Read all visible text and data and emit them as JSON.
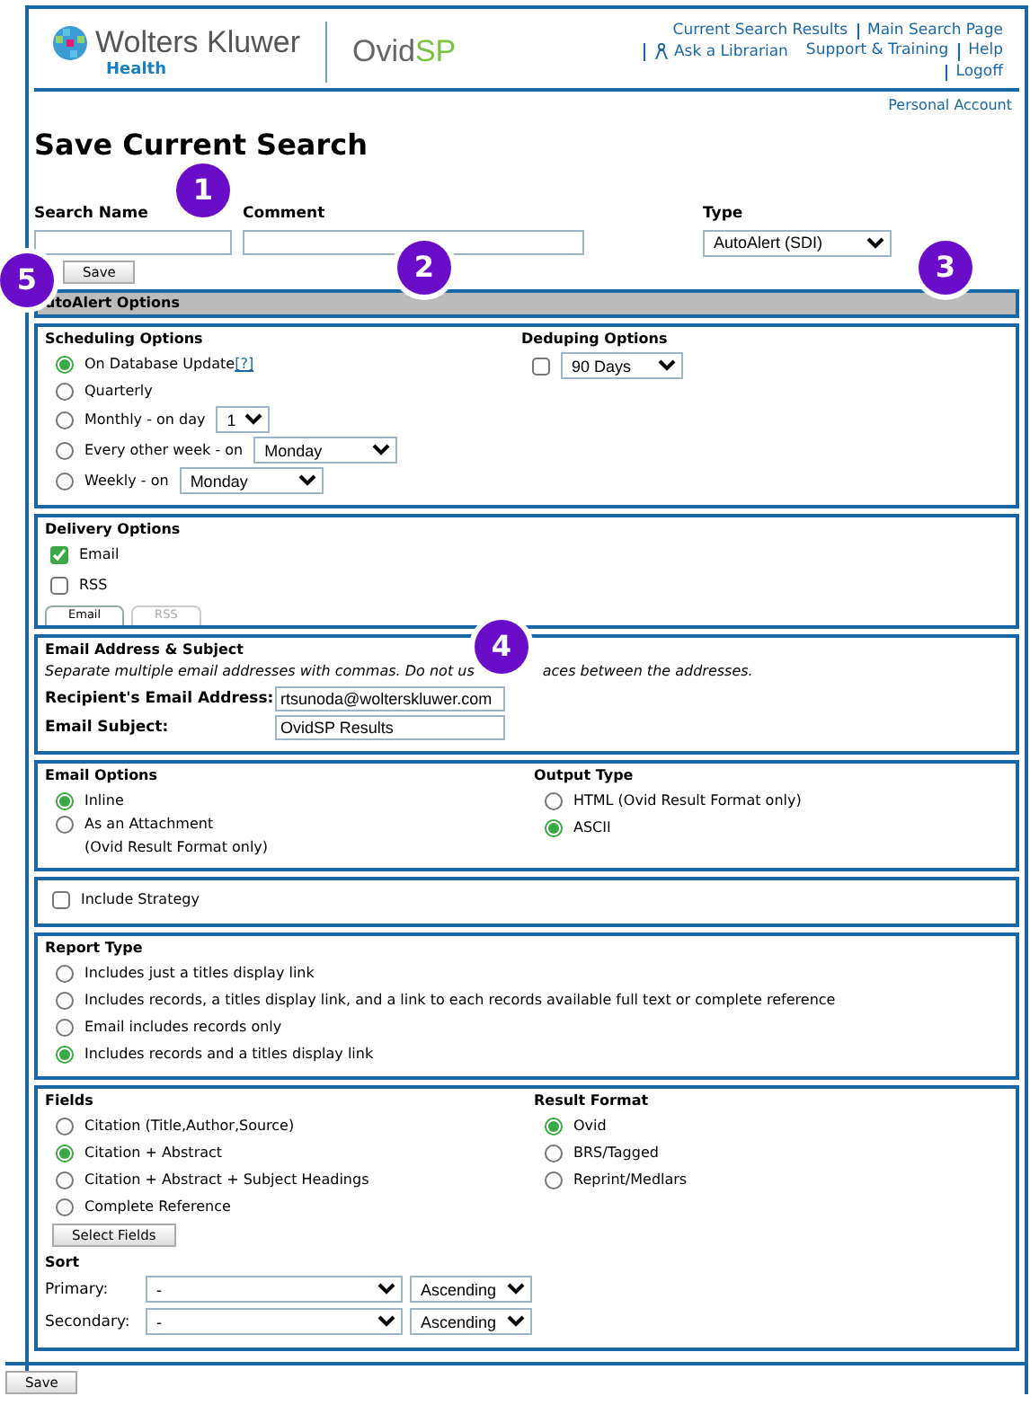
{
  "header": {
    "logo_text": "Wolters Kluwer",
    "logo_subtext": "Health",
    "product": "Ovid",
    "product_accent": "SP",
    "links": [
      "Current Search Results",
      "Main Search Page",
      "Ask a Librarian",
      "Support & Training",
      "Help",
      "Logoff"
    ],
    "account_link": "Personal Account"
  },
  "title": "Save Current Search",
  "save_form": {
    "fields": [
      {
        "label": "Search Name",
        "kind": "text",
        "callout": "1"
      },
      {
        "label": "Comment",
        "kind": "text",
        "callout": "2"
      },
      {
        "label": "Type",
        "kind": "select",
        "value": "AutoAlert (SDI)",
        "callout": "3"
      }
    ],
    "button": {
      "label": "Save",
      "callout": "5"
    }
  },
  "autoalert_header": "utoAlert Options",
  "scheduling": {
    "title": "Scheduling Options",
    "options": [
      {
        "label": "On Database Update",
        "help": "[?]",
        "selected": true
      },
      {
        "label": "Quarterly",
        "selected": false
      },
      {
        "label": "Monthly - on day",
        "select": "1",
        "selected": false
      },
      {
        "label": "Every other week - on",
        "select": "Monday",
        "selected": false
      },
      {
        "label": "Weekly - on",
        "select": "Monday",
        "selected": false
      }
    ]
  },
  "deduping": {
    "title": "Deduping Options",
    "checked": false,
    "select": "90 Days"
  },
  "delivery": {
    "title": "Delivery Options",
    "options": [
      {
        "label": "Email",
        "checked": true
      },
      {
        "label": "RSS",
        "checked": false
      }
    ],
    "tabs": [
      {
        "label": "Email",
        "selected": true
      },
      {
        "label": "RSS",
        "selected": false
      }
    ]
  },
  "email_address": {
    "title": "Email Address & Subject",
    "callout": "4",
    "note_parts": [
      "Separate multiple email addresses with commas. Do not us",
      "aces between the addresses."
    ],
    "fields": [
      {
        "label": "Recipient's Email Address:",
        "value": "rtsunoda@wolterskluwer.com"
      },
      {
        "label": "Email Subject:",
        "value": "OvidSP Results"
      }
    ]
  },
  "email_options": {
    "title": "Email Options",
    "options": [
      {
        "label": "Inline",
        "selected": true
      },
      {
        "label": "As an Attachment",
        "note": "(Ovid Result Format only)",
        "selected": false
      }
    ]
  },
  "output_type": {
    "title": "Output Type",
    "options": [
      {
        "label": "HTML (Ovid Result Format only)",
        "selected": false
      },
      {
        "label": "ASCII",
        "selected": true
      }
    ]
  },
  "include_strategy": {
    "label": "Include Strategy",
    "checked": false
  },
  "report_type": {
    "title": "Report Type",
    "options": [
      {
        "label": "Includes just a titles display link",
        "selected": false
      },
      {
        "label": "Includes records, a titles display link, and a link to each records available full text or complete reference",
        "selected": false
      },
      {
        "label": "Email includes records only",
        "selected": false
      },
      {
        "label": "Includes records and a titles display link",
        "selected": true
      }
    ]
  },
  "fields": {
    "title": "Fields",
    "options": [
      {
        "label": "Citation (Title,Author,Source)",
        "selected": false
      },
      {
        "label": "Citation + Abstract",
        "selected": true
      },
      {
        "label": "Citation + Abstract + Subject Headings",
        "selected": false
      },
      {
        "label": "Complete Reference",
        "selected": false
      }
    ],
    "button": "Select Fields"
  },
  "result_format": {
    "title": "Result Format",
    "options": [
      {
        "label": "Ovid",
        "selected": true
      },
      {
        "label": "BRS/Tagged",
        "selected": false
      },
      {
        "label": "Reprint/Medlars",
        "selected": false
      }
    ]
  },
  "sort": {
    "title": "Sort",
    "rows": [
      {
        "label": "Primary:",
        "field": "-",
        "order": "Ascending"
      },
      {
        "label": "Secondary:",
        "field": "-",
        "order": "Ascending"
      }
    ]
  },
  "footer_button": "Save"
}
